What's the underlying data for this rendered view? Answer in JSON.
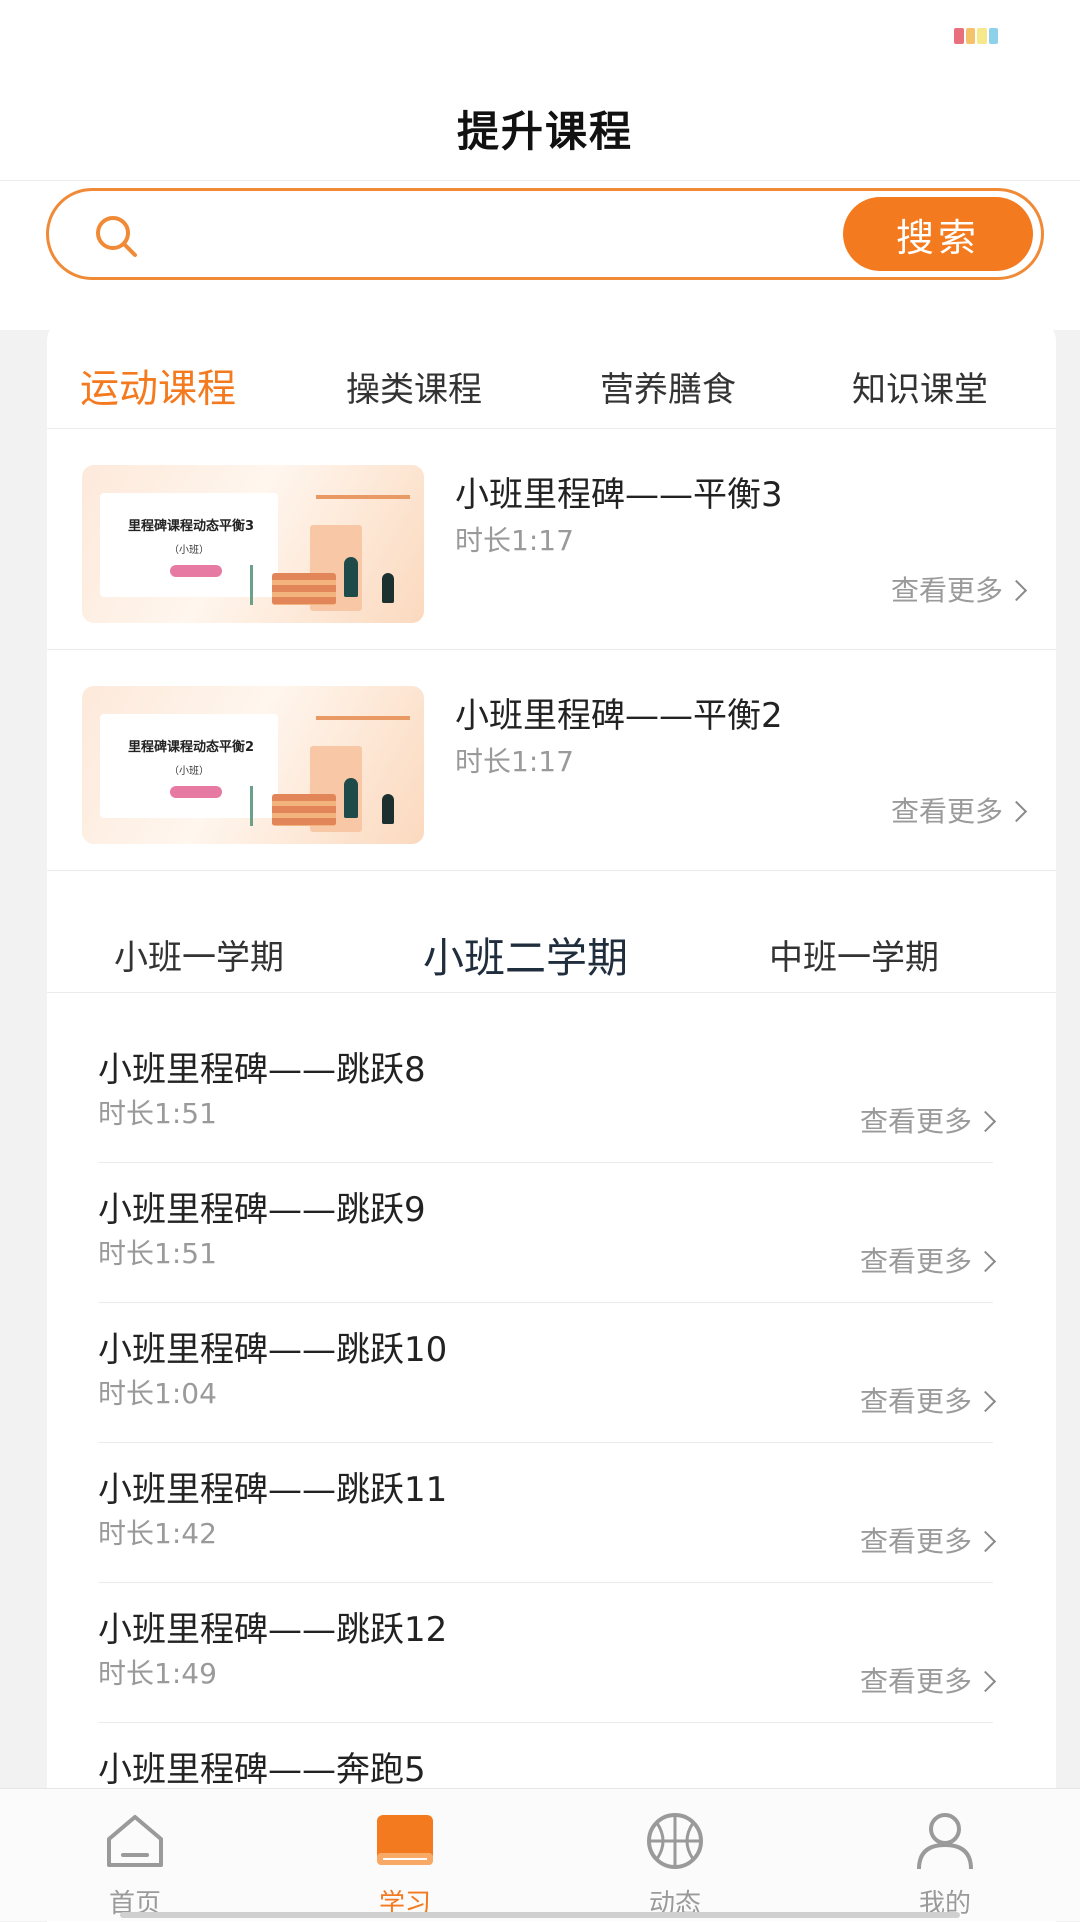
{
  "header": {
    "title": "提升课程"
  },
  "search": {
    "placeholder": "",
    "button_label": "搜索"
  },
  "category_tabs": [
    {
      "label": "运动课程",
      "active": true
    },
    {
      "label": "操类课程",
      "active": false
    },
    {
      "label": "营养膳食",
      "active": false
    },
    {
      "label": "知识课堂",
      "active": false
    }
  ],
  "featured": [
    {
      "title": "小班里程碑——平衡3",
      "duration": "时长1:17",
      "more": "查看更多",
      "thumb_text": "里程碑课程动态平衡3",
      "thumb_sub": "（小班）"
    },
    {
      "title": "小班里程碑——平衡2",
      "duration": "时长1:17",
      "more": "查看更多",
      "thumb_text": "里程碑课程动态平衡2",
      "thumb_sub": "（小班）"
    }
  ],
  "term_tabs": [
    {
      "label": "小班一学期",
      "active": false
    },
    {
      "label": "小班二学期",
      "active": true
    },
    {
      "label": "中班一学期",
      "active": false
    }
  ],
  "lessons": [
    {
      "title": "小班里程碑——跳跃8",
      "duration": "时长1:51",
      "more": "查看更多"
    },
    {
      "title": "小班里程碑——跳跃9",
      "duration": "时长1:51",
      "more": "查看更多"
    },
    {
      "title": "小班里程碑——跳跃10",
      "duration": "时长1:04",
      "more": "查看更多"
    },
    {
      "title": "小班里程碑——跳跃11",
      "duration": "时长1:42",
      "more": "查看更多"
    },
    {
      "title": "小班里程碑——跳跃12",
      "duration": "时长1:49",
      "more": "查看更多"
    },
    {
      "title": "小班里程碑——奔跑5",
      "duration": "",
      "more": ""
    }
  ],
  "tab_bar": [
    {
      "label": "首页",
      "icon": "home-icon",
      "active": false
    },
    {
      "label": "学习",
      "icon": "book-icon",
      "active": true
    },
    {
      "label": "动态",
      "icon": "basketball-icon",
      "active": false
    },
    {
      "label": "我的",
      "icon": "person-icon",
      "active": false
    }
  ],
  "colors": {
    "accent": "#f47a1f",
    "search_border": "#f08a36",
    "muted": "#9a9a9a"
  }
}
